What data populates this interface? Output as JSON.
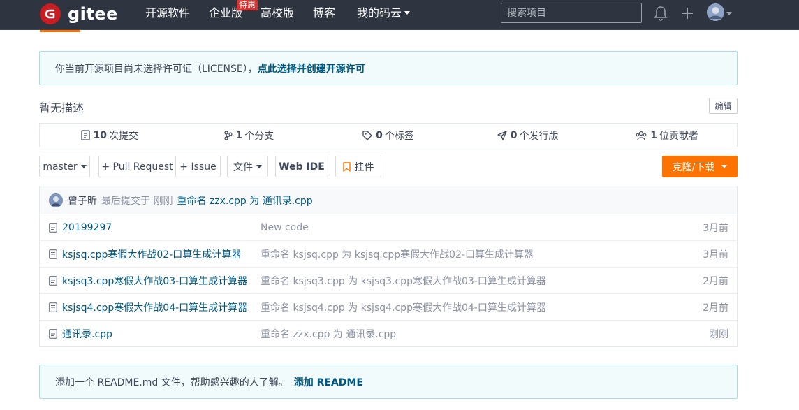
{
  "nav": {
    "logo_text": "gitee",
    "items": [
      "开源软件",
      "企业版",
      "高校版",
      "博客",
      "我的码云"
    ],
    "badge": "特惠",
    "search_placeholder": "搜索项目"
  },
  "license_notice": {
    "text": "你当前开源项目尚未选择许可证（LICENSE），",
    "link": "点此选择并创建开源许可"
  },
  "description": "暂无描述",
  "edit_label": "编辑",
  "stats": [
    {
      "icon": "commit-icon",
      "count": "10",
      "label": "次提交"
    },
    {
      "icon": "branch-icon",
      "count": "1",
      "label": "个分支"
    },
    {
      "icon": "tag-icon",
      "count": "0",
      "label": "个标签"
    },
    {
      "icon": "release-icon",
      "count": "0",
      "label": "个发行版"
    },
    {
      "icon": "contributors-icon",
      "count": "1",
      "label": "位贡献者"
    }
  ],
  "toolbar": {
    "branch": "master",
    "pull_request": "+ Pull Request",
    "issue": "+ Issue",
    "file": "文件",
    "web_ide": "Web IDE",
    "widget": "挂件",
    "clone": "克隆/下载"
  },
  "last_commit": {
    "author": "曾子昕",
    "time": "最后提交于 刚刚",
    "message": "重命名 zzx.cpp 为 通讯录.cpp"
  },
  "files": [
    {
      "name": "20199297",
      "message": "New code",
      "time": "3月前"
    },
    {
      "name": "ksjsq.cpp寒假大作战02-口算生成计算器",
      "message": "重命名 ksjsq.cpp 为 ksjsq.cpp寒假大作战02-口算生成计算器",
      "time": "3月前"
    },
    {
      "name": "ksjsq3.cpp寒假大作战03-口算生成计算器",
      "message": "重命名 ksjsq3.cpp 为 ksjsq3.cpp寒假大作战03-口算生成计算器",
      "time": "2月前"
    },
    {
      "name": "ksjsq4.cpp寒假大作战04-口算生成计算器",
      "message": "重命名 ksjsq4.cpp 为 ksjsq4.cpp寒假大作战04-口算生成计算器",
      "time": "2月前"
    },
    {
      "name": "通讯录.cpp",
      "message": "重命名 zzx.cpp 为 通讯录.cpp",
      "time": "刚刚"
    }
  ],
  "readme_notice": {
    "text": "添加一个 README.md 文件，帮助感兴趣的人了解。",
    "link": "添加 README"
  },
  "colors": {
    "nav_bg": "#2e3440",
    "accent": "#fe7300",
    "link": "#005980",
    "logo": "#c71d23"
  }
}
